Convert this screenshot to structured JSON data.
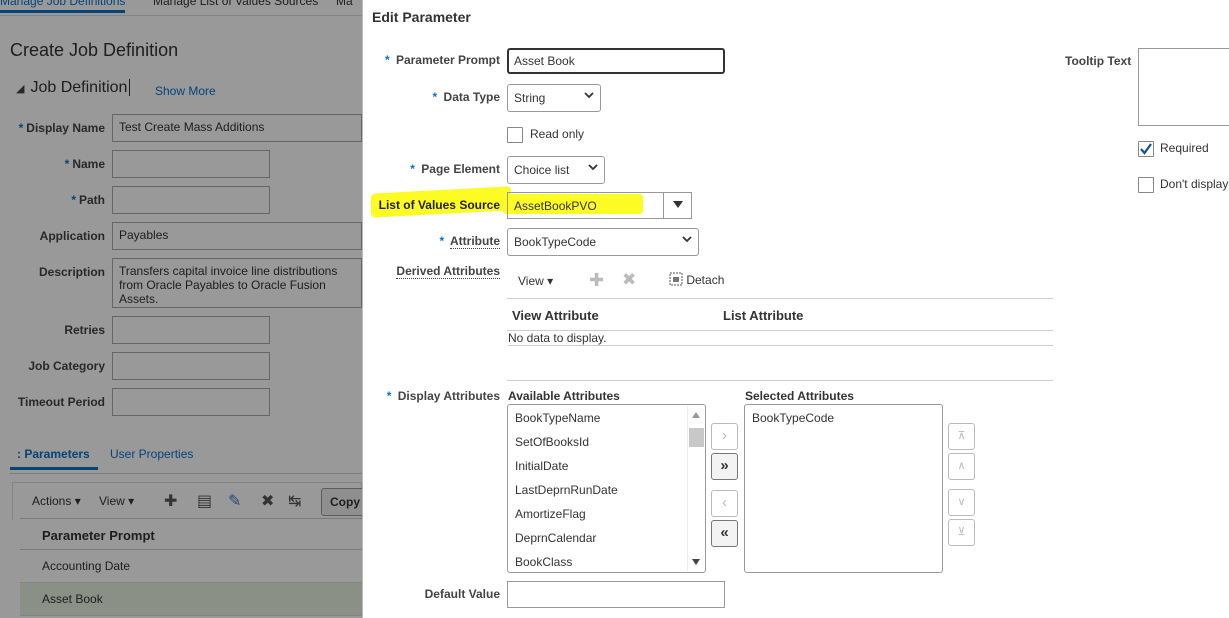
{
  "background": {
    "top_tabs": [
      "Manage Job Definitions",
      "Manage List of Values Sources",
      "Ma"
    ],
    "page_title": "Create Job Definition",
    "section_title": "Job Definition",
    "show_more": "Show More",
    "fields": {
      "display_name": {
        "label": "Display Name",
        "value": "Test Create Mass Additions"
      },
      "name": {
        "label": "Name",
        "value": ""
      },
      "path": {
        "label": "Path",
        "value": ""
      },
      "application": {
        "label": "Application",
        "value": "Payables"
      },
      "description": {
        "label": "Description",
        "value": "Transfers capital invoice line distributions from Oracle Payables to Oracle Fusion Assets."
      },
      "retries": {
        "label": "Retries",
        "value": ""
      },
      "job_category": {
        "label": "Job Category",
        "value": ""
      },
      "timeout_period": {
        "label": "Timeout Period",
        "value": ""
      }
    },
    "subtabs": [
      ": Parameters",
      "User Properties"
    ],
    "toolbar": {
      "actions": "Actions",
      "view": "View",
      "copy": "Copy"
    },
    "table": {
      "header": "Parameter Prompt",
      "rows": [
        "Accounting Date",
        "Asset Book"
      ]
    }
  },
  "dialog": {
    "title": "Edit Parameter",
    "parameter_prompt": {
      "label": "Parameter Prompt",
      "value": "Asset Book"
    },
    "data_type": {
      "label": "Data Type",
      "value": "String"
    },
    "read_only": {
      "label": "Read only",
      "checked": false
    },
    "page_element": {
      "label": "Page Element",
      "value": "Choice list"
    },
    "lov_source": {
      "label": "List of Values Source",
      "value": "AssetBookPVO"
    },
    "attribute": {
      "label": "Attribute",
      "value": "BookTypeCode"
    },
    "derived_attributes": {
      "label": "Derived Attributes",
      "view": "View",
      "detach": "Detach",
      "columns": [
        "View Attribute",
        "List Attribute"
      ],
      "empty_text": "No data to display."
    },
    "display_attributes": {
      "label": "Display Attributes",
      "available_label": "Available Attributes",
      "available": [
        "BookTypeName",
        "SetOfBooksId",
        "InitialDate",
        "LastDeprnRunDate",
        "AmortizeFlag",
        "DeprnCalendar",
        "BookClass"
      ],
      "selected_label": "Selected Attributes",
      "selected": [
        "BookTypeCode"
      ]
    },
    "default_value": {
      "label": "Default Value",
      "value": ""
    },
    "tooltip_text": {
      "label": "Tooltip Text",
      "value": ""
    },
    "required": {
      "label": "Required",
      "checked": true
    },
    "dont_display": {
      "label": "Don't display",
      "checked": false
    },
    "highlight_color": "#fdfb24",
    "accent_color": "#0572ce"
  }
}
